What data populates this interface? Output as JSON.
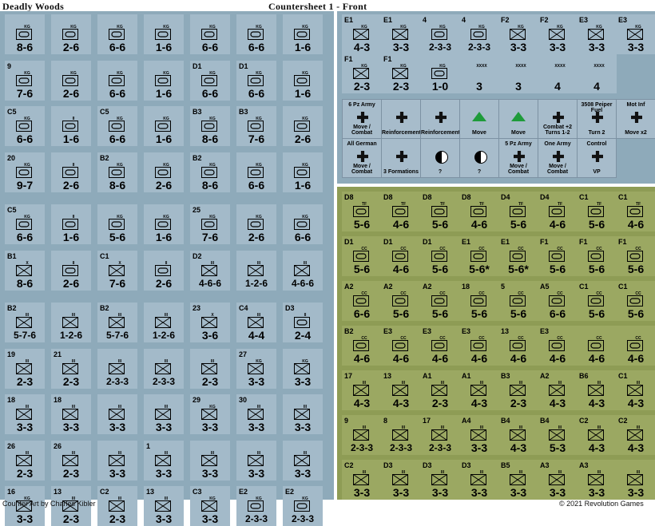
{
  "header": {
    "left_title": "Deadly Woods",
    "right_title": "Countersheet 1 - Front"
  },
  "footer": {
    "credit": "Counter Art by Charles Kibler",
    "copyright": "© 2021 Revolution Games"
  },
  "colors": {
    "german_panel": "#8eaaba",
    "us_panel": "#8e9c55",
    "german_counter": "#a3bac9",
    "us_counter": "#9ba862"
  },
  "german_left": [
    [
      "",
      "KG",
      "8-6"
    ],
    [
      "",
      "KG",
      "2-6"
    ],
    [
      "",
      "KG",
      "6-6"
    ],
    [
      "",
      "KG",
      "1-6"
    ],
    [
      "",
      "KG",
      "6-6"
    ],
    [
      "",
      "KG",
      "6-6"
    ],
    [
      "",
      "KG",
      "1-6"
    ],
    [
      "9",
      "KG",
      "7-6"
    ],
    [
      "",
      "KG",
      "2-6"
    ],
    [
      "",
      "KG",
      "6-6"
    ],
    [
      "",
      "KG",
      "1-6"
    ],
    [
      "D1",
      "KG",
      "6-6"
    ],
    [
      "D1",
      "KG",
      "6-6"
    ],
    [
      "",
      "KG",
      "1-6"
    ],
    [
      "C5",
      "KG",
      "6-6"
    ],
    [
      "",
      "II",
      "1-6"
    ],
    [
      "C5",
      "KG",
      "6-6"
    ],
    [
      "",
      "KG",
      "1-6"
    ],
    [
      "B3",
      "KG",
      "8-6"
    ],
    [
      "B3",
      "KG",
      "7-6"
    ],
    [
      "",
      "KG",
      "2-6"
    ],
    [
      "20",
      "KG",
      "9-7"
    ],
    [
      "",
      "II",
      "2-6"
    ],
    [
      "B2",
      "KG",
      "8-6"
    ],
    [
      "",
      "KG",
      "2-6"
    ],
    [
      "B2",
      "KG",
      "8-6"
    ],
    [
      "",
      "KG",
      "6-6"
    ],
    [
      "",
      "KG",
      "1-6"
    ],
    [
      "C5",
      "KG",
      "6-6"
    ],
    [
      "",
      "II",
      "1-6"
    ],
    [
      "",
      "KG",
      "5-6"
    ],
    [
      "",
      "KG",
      "1-6"
    ],
    [
      "25",
      "KG",
      "7-6"
    ],
    [
      "",
      "KG",
      "2-6"
    ],
    [
      "",
      "KG",
      "6-6"
    ],
    [
      "B1",
      "X",
      "8-6"
    ],
    [
      "",
      "II",
      "2-6"
    ],
    [
      "C1",
      "X",
      "7-6"
    ],
    [
      "",
      "II",
      "2-6"
    ],
    [
      "D2",
      "III",
      "4-6-6"
    ],
    [
      "",
      "III",
      "1-2-6"
    ],
    [
      "",
      "III",
      "4-6-6"
    ],
    [
      "B2",
      "III",
      "5-7-6"
    ],
    [
      "",
      "III",
      "1-2-6"
    ],
    [
      "B2",
      "III",
      "5-7-6"
    ],
    [
      "",
      "III",
      "1-2-6"
    ],
    [
      "23",
      "X",
      "3-6"
    ],
    [
      "C4",
      "III",
      "4-4"
    ],
    [
      "D3",
      "II",
      "2-4"
    ],
    [
      "19",
      "III",
      "2-3"
    ],
    [
      "21",
      "III",
      "2-3"
    ],
    [
      "",
      "III",
      "2-3-3"
    ],
    [
      "",
      "III",
      "2-3-3"
    ],
    [
      "",
      "III",
      "2-3"
    ],
    [
      "27",
      "KG",
      "3-3"
    ],
    [
      "",
      "KG",
      "3-3"
    ],
    [
      "18",
      "III",
      "3-3"
    ],
    [
      "18",
      "III",
      "3-3"
    ],
    [
      "",
      "III",
      "3-3"
    ],
    [
      "",
      "III",
      "3-3"
    ],
    [
      "29",
      "KG",
      "3-3"
    ],
    [
      "30",
      "III",
      "3-3"
    ],
    [
      "",
      "III",
      "3-3"
    ],
    [
      "26",
      "III",
      "2-3"
    ],
    [
      "26",
      "III",
      "2-3"
    ],
    [
      "",
      "III",
      "3-3"
    ],
    [
      "1",
      "III",
      "3-3"
    ],
    [
      "",
      "III",
      "3-3"
    ],
    [
      "",
      "III",
      "3-3"
    ],
    [
      "",
      "III",
      "3-3"
    ],
    [
      "16",
      "KG",
      "3-3"
    ],
    [
      "13",
      "III",
      "2-3"
    ],
    [
      "C2",
      "III",
      "2-3"
    ],
    [
      "13",
      "III",
      "3-3"
    ],
    [
      "C3",
      "KG",
      "3-3"
    ],
    [
      "E2",
      "KG",
      "2-3-3"
    ],
    [
      "E2",
      "KG",
      "2-3-3"
    ]
  ],
  "german_right": [
    [
      "E1",
      "KG",
      "4-3"
    ],
    [
      "E1",
      "KG",
      "3-3"
    ],
    [
      "4",
      "KG",
      "2-3-3"
    ],
    [
      "4",
      "KG",
      "2-3-3"
    ],
    [
      "F2",
      "KG",
      "3-3"
    ],
    [
      "F2",
      "KG",
      "3-3"
    ],
    [
      "E3",
      "KG",
      "3-3"
    ],
    [
      "E3",
      "KG",
      "3-3"
    ],
    [
      "F1",
      "KG",
      "2-3"
    ],
    [
      "F1",
      "KG",
      "2-3"
    ],
    [
      "",
      "KG",
      "1-0"
    ],
    [
      "",
      "XXXX",
      "3"
    ],
    [
      "",
      "XXXX",
      "3"
    ],
    [
      "",
      "XXXX",
      "4"
    ],
    [
      "",
      "XXXX",
      "4"
    ]
  ],
  "markers": [
    {
      "top": "6 Pz Army",
      "bottom": "Move / Combat"
    },
    {
      "top": "",
      "bottom": "Reinforcement"
    },
    {
      "top": "",
      "bottom": "Reinforcement"
    },
    {
      "top": "",
      "bottom": "Move"
    },
    {
      "top": "",
      "bottom": "Move"
    },
    {
      "top": "",
      "bottom": "Combat +2 Turns 1-2"
    },
    {
      "top": "3508 Peiper Fuel",
      "bottom": "Turn 2"
    },
    {
      "top": "Mot Inf",
      "bottom": "Move x2"
    },
    {
      "top": "All German",
      "bottom": "Move / Combat"
    },
    {
      "top": "",
      "bottom": "3 Formations"
    },
    {
      "top": "",
      "bottom": "?"
    },
    {
      "top": "",
      "bottom": "?"
    },
    {
      "top": "5 Pz Army",
      "bottom": "Move / Combat"
    },
    {
      "top": "One Army",
      "bottom": "Move / Combat"
    },
    {
      "top": "Control",
      "bottom": "VP"
    }
  ],
  "us_right": [
    [
      "D8",
      "TF",
      "5-6"
    ],
    [
      "D8",
      "TF",
      "4-6"
    ],
    [
      "D8",
      "TF",
      "5-6"
    ],
    [
      "D8",
      "TF",
      "4-6"
    ],
    [
      "D4",
      "TF",
      "5-6"
    ],
    [
      "D4",
      "TF",
      "4-6"
    ],
    [
      "C1",
      "TF",
      "5-6"
    ],
    [
      "C1",
      "TF",
      "4-6"
    ],
    [
      "D1",
      "CC",
      "5-6"
    ],
    [
      "D1",
      "CC",
      "4-6"
    ],
    [
      "D1",
      "CC",
      "5-6"
    ],
    [
      "E1",
      "CC",
      "5-6*"
    ],
    [
      "E1",
      "CC",
      "5-6*"
    ],
    [
      "F1",
      "CC",
      "5-6"
    ],
    [
      "F1",
      "CC",
      "5-6"
    ],
    [
      "F1",
      "CC",
      "5-6"
    ],
    [
      "A2",
      "CC",
      "6-6"
    ],
    [
      "A2",
      "CC",
      "5-6"
    ],
    [
      "A2",
      "CC",
      "5-6"
    ],
    [
      "18",
      "CC",
      "5-6"
    ],
    [
      "5",
      "CC",
      "5-6"
    ],
    [
      "A5",
      "CC",
      "6-6"
    ],
    [
      "C1",
      "CC",
      "5-6"
    ],
    [
      "C1",
      "CC",
      "5-6"
    ],
    [
      "B2",
      "CC",
      "4-6"
    ],
    [
      "E3",
      "CC",
      "4-6"
    ],
    [
      "E3",
      "CC",
      "4-6"
    ],
    [
      "E3",
      "CC",
      "4-6"
    ],
    [
      "13",
      "CC",
      "4-6"
    ],
    [
      "E3",
      "CC",
      "4-6"
    ],
    [
      "",
      "CC",
      "4-6"
    ],
    [
      "",
      "CC",
      "4-6"
    ],
    [
      "17",
      "III",
      "4-3"
    ],
    [
      "13",
      "III",
      "4-3"
    ],
    [
      "A1",
      "III",
      "2-3"
    ],
    [
      "A1",
      "III",
      "4-3"
    ],
    [
      "B3",
      "III",
      "2-3"
    ],
    [
      "A2",
      "III",
      "4-3"
    ],
    [
      "B6",
      "III",
      "4-3"
    ],
    [
      "C1",
      "III",
      "4-3"
    ],
    [
      "9",
      "III",
      "2-3-3"
    ],
    [
      "8",
      "III",
      "2-3-3"
    ],
    [
      "17",
      "III",
      "2-3-3"
    ],
    [
      "A4",
      "III",
      "3-3"
    ],
    [
      "B4",
      "III",
      "4-3"
    ],
    [
      "B4",
      "III",
      "5-3"
    ],
    [
      "C2",
      "III",
      "4-3"
    ],
    [
      "C2",
      "III",
      "4-3"
    ],
    [
      "C2",
      "III",
      "3-3"
    ],
    [
      "D3",
      "III",
      "3-3"
    ],
    [
      "D3",
      "III",
      "3-3"
    ],
    [
      "D3",
      "III",
      "3-3"
    ],
    [
      "B5",
      "III",
      "3-3"
    ],
    [
      "A3",
      "III",
      "3-3"
    ],
    [
      "A3",
      "III",
      "3-3"
    ],
    [
      "",
      "III",
      "3-3"
    ]
  ]
}
